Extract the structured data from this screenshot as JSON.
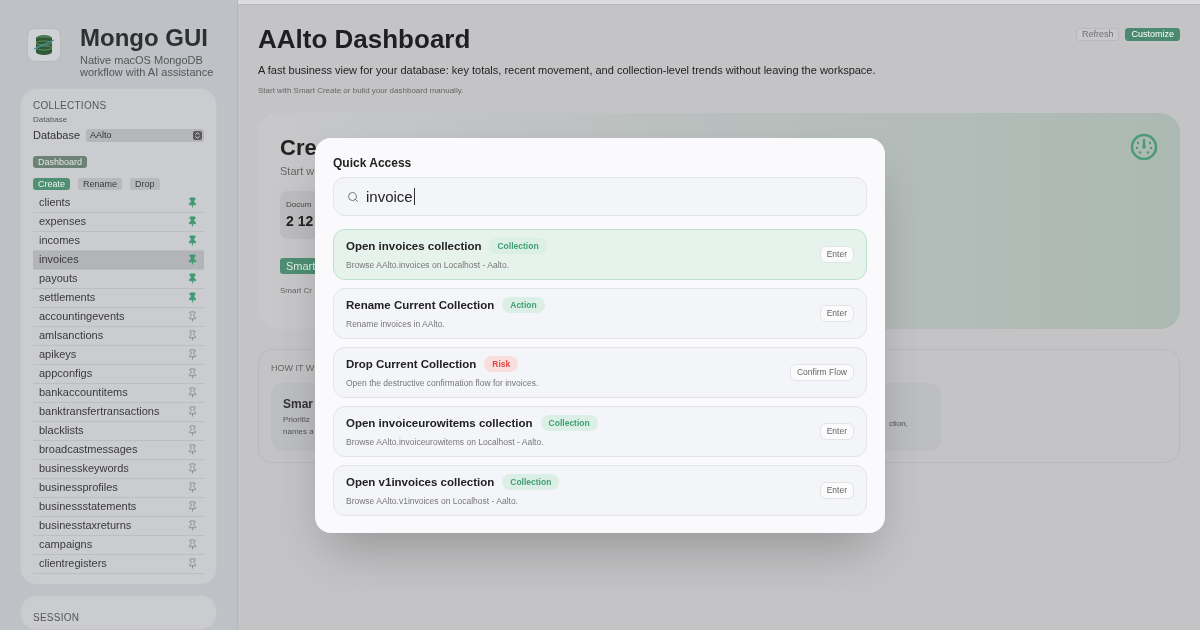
{
  "app": {
    "title": "Mongo GUI",
    "subtitle": "Native macOS MongoDB workflow with AI assistance"
  },
  "collections_panel": {
    "heading": "COLLECTIONS",
    "database_caption": "Database",
    "database_label": "Database",
    "database_value": "AAlto",
    "dashboard_button": "Dashboard",
    "actions": [
      {
        "label": "Create",
        "kind": "primary"
      },
      {
        "label": "Rename",
        "kind": "secondary"
      },
      {
        "label": "Drop",
        "kind": "secondary"
      }
    ],
    "items": [
      {
        "name": "clients",
        "pinned": true,
        "selected": false
      },
      {
        "name": "expenses",
        "pinned": true,
        "selected": false
      },
      {
        "name": "incomes",
        "pinned": true,
        "selected": false
      },
      {
        "name": "invoices",
        "pinned": true,
        "selected": true
      },
      {
        "name": "payouts",
        "pinned": true,
        "selected": false
      },
      {
        "name": "settlements",
        "pinned": true,
        "selected": false
      },
      {
        "name": "accountingevents",
        "pinned": false,
        "selected": false
      },
      {
        "name": "amlsanctions",
        "pinned": false,
        "selected": false
      },
      {
        "name": "apikeys",
        "pinned": false,
        "selected": false
      },
      {
        "name": "appconfigs",
        "pinned": false,
        "selected": false
      },
      {
        "name": "bankaccountitems",
        "pinned": false,
        "selected": false
      },
      {
        "name": "banktransfertransactions",
        "pinned": false,
        "selected": false
      },
      {
        "name": "blacklists",
        "pinned": false,
        "selected": false
      },
      {
        "name": "broadcastmessages",
        "pinned": false,
        "selected": false
      },
      {
        "name": "businesskeywords",
        "pinned": false,
        "selected": false
      },
      {
        "name": "businessprofiles",
        "pinned": false,
        "selected": false
      },
      {
        "name": "businessstatements",
        "pinned": false,
        "selected": false
      },
      {
        "name": "businesstaxreturns",
        "pinned": false,
        "selected": false
      },
      {
        "name": "campaigns",
        "pinned": false,
        "selected": false
      },
      {
        "name": "clientregisters",
        "pinned": false,
        "selected": false
      }
    ]
  },
  "session_panel": {
    "heading": "SESSION"
  },
  "header": {
    "title": "AAlto Dashboard",
    "description": "A fast business view for your database: key totals, recent movement, and collection-level trends without leaving the workspace.",
    "hint": "Start with Smart Create or build your dashboard manually.",
    "buttons": [
      {
        "label": "Refresh",
        "kind": "secondary"
      },
      {
        "label": "Customize",
        "kind": "primary"
      }
    ]
  },
  "hero_card": {
    "title": "Cre",
    "subtitle": "Start w",
    "stat": {
      "label": "Docum",
      "value": "2 12"
    },
    "button": "Smart",
    "note": "Smart Cr"
  },
  "how_it_works": {
    "heading": "HOW IT W",
    "cards": [
      {
        "title": "Smar",
        "lines": [
          "Prioritiz",
          "names a"
        ]
      },
      {
        "lines": [
          "ction,"
        ]
      }
    ]
  },
  "quick_access": {
    "title": "Quick Access",
    "search": {
      "value": "invoice"
    },
    "results": [
      {
        "title": "Open invoices collection",
        "badge": "Collection",
        "kind": "collection",
        "description": "Browse AAlto.invoices on Localhost - Aalto.",
        "key": "Enter",
        "selected": true
      },
      {
        "title": "Rename Current Collection",
        "badge": "Action",
        "kind": "action",
        "description": "Rename invoices in AAlto.",
        "key": "Enter",
        "selected": false
      },
      {
        "title": "Drop Current Collection",
        "badge": "Risk",
        "kind": "risk",
        "description": "Open the destructive confirmation flow for invoices.",
        "key": "Confirm Flow",
        "selected": false
      },
      {
        "title": "Open invoiceurowitems collection",
        "badge": "Collection",
        "kind": "collection",
        "description": "Browse AAlto.invoiceurowitems on Localhost - Aalto.",
        "key": "Enter",
        "selected": false
      },
      {
        "title": "Open v1invoices collection",
        "badge": "Collection",
        "kind": "collection",
        "description": "Browse AAlto.v1invoices on Localhost - Aalto.",
        "key": "Enter",
        "selected": false
      }
    ]
  }
}
